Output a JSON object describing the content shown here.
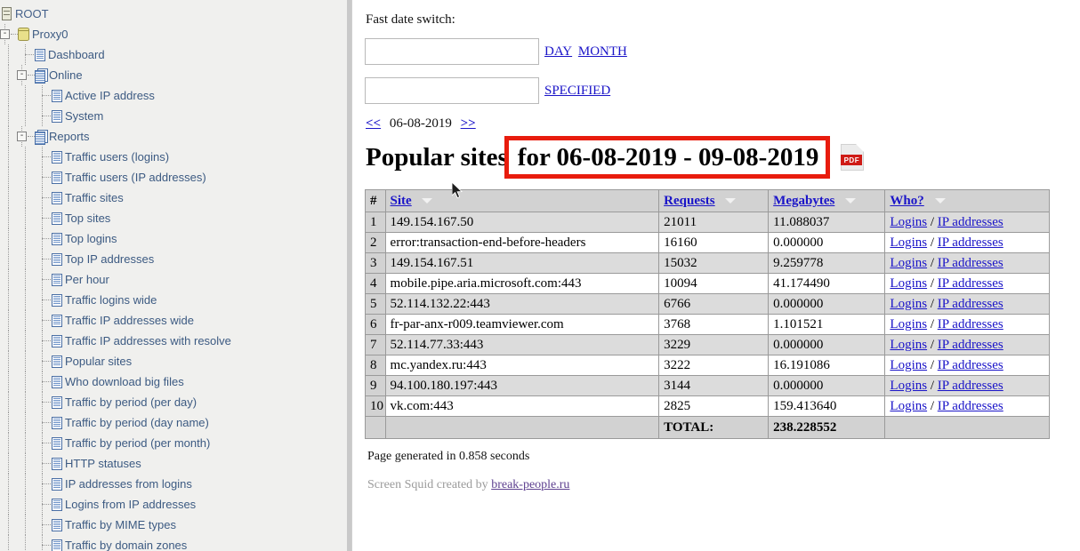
{
  "sidebar": {
    "root_label": "ROOT",
    "root_icon": "server-stack-icon",
    "items": [
      {
        "label": "Proxy0",
        "depth": 1,
        "icon": "cylinder-icon",
        "toggle": "-"
      },
      {
        "label": "Dashboard",
        "depth": 2,
        "icon": "page-icon",
        "toggle": ""
      },
      {
        "label": "Online",
        "depth": 2,
        "icon": "multi-page-icon",
        "toggle": "-"
      },
      {
        "label": "Active IP address",
        "depth": 3,
        "icon": "page-icon",
        "toggle": ""
      },
      {
        "label": "System",
        "depth": 3,
        "icon": "page-icon",
        "toggle": ""
      },
      {
        "label": "Reports",
        "depth": 2,
        "icon": "multi-page-icon",
        "toggle": "-"
      },
      {
        "label": "Traffic users (logins)",
        "depth": 3,
        "icon": "page-icon",
        "toggle": ""
      },
      {
        "label": "Traffic users (IP addresses)",
        "depth": 3,
        "icon": "page-icon",
        "toggle": ""
      },
      {
        "label": "Traffic sites",
        "depth": 3,
        "icon": "page-icon",
        "toggle": ""
      },
      {
        "label": "Top sites",
        "depth": 3,
        "icon": "page-icon",
        "toggle": ""
      },
      {
        "label": "Top logins",
        "depth": 3,
        "icon": "page-icon",
        "toggle": ""
      },
      {
        "label": "Top IP addresses",
        "depth": 3,
        "icon": "page-icon",
        "toggle": ""
      },
      {
        "label": "Per hour",
        "depth": 3,
        "icon": "page-icon",
        "toggle": ""
      },
      {
        "label": "Traffic logins wide",
        "depth": 3,
        "icon": "page-icon",
        "toggle": ""
      },
      {
        "label": "Traffic IP addresses wide",
        "depth": 3,
        "icon": "page-icon",
        "toggle": ""
      },
      {
        "label": "Traffic IP addresses with resolve",
        "depth": 3,
        "icon": "page-icon",
        "toggle": ""
      },
      {
        "label": "Popular sites",
        "depth": 3,
        "icon": "page-icon",
        "toggle": ""
      },
      {
        "label": "Who download big files",
        "depth": 3,
        "icon": "page-icon",
        "toggle": ""
      },
      {
        "label": "Traffic by period (per day)",
        "depth": 3,
        "icon": "page-icon",
        "toggle": ""
      },
      {
        "label": "Traffic by period (day name)",
        "depth": 3,
        "icon": "page-icon",
        "toggle": ""
      },
      {
        "label": "Traffic by period (per month)",
        "depth": 3,
        "icon": "page-icon",
        "toggle": ""
      },
      {
        "label": "HTTP statuses",
        "depth": 3,
        "icon": "page-icon",
        "toggle": ""
      },
      {
        "label": "IP addresses from logins",
        "depth": 3,
        "icon": "page-icon",
        "toggle": ""
      },
      {
        "label": "Logins from IP addresses",
        "depth": 3,
        "icon": "page-icon",
        "toggle": ""
      },
      {
        "label": "Traffic by MIME types",
        "depth": 3,
        "icon": "page-icon",
        "toggle": ""
      },
      {
        "label": "Traffic by domain zones",
        "depth": 3,
        "icon": "page-icon",
        "toggle": ""
      }
    ]
  },
  "main": {
    "fast_date_switch_label": "Fast date switch:",
    "date_input_1": "",
    "date_input_2": "",
    "date_input_placeholder": "",
    "link_day": "DAY",
    "link_month": "MONTH",
    "link_specified": "SPECIFIED",
    "nav_prev": "<<",
    "nav_date": "06-08-2019",
    "nav_next": ">>",
    "title_prefix": "Popular sites",
    "title_highlighted": "for 06-08-2019 - 09-08-2019",
    "highlight_color": "#e81c0d",
    "pdf_icon_label": "PDF",
    "generated_text": "Page generated in 0.858 seconds",
    "credit_prefix": "Screen Squid created by ",
    "credit_link": "break-people.ru"
  },
  "table": {
    "columns": [
      "#",
      "Site",
      "Requests",
      "Megabytes",
      "Who?"
    ],
    "who_login_label": "Logins",
    "who_sep": " / ",
    "who_ip_label": "IP addresses",
    "total_label": "TOTAL:",
    "total_value": "238.228552",
    "rows": [
      {
        "num": "1",
        "site": "149.154.167.50",
        "requests": "21011",
        "megabytes": "11.088037"
      },
      {
        "num": "2",
        "site": "error:transaction-end-before-headers",
        "requests": "16160",
        "megabytes": "0.000000"
      },
      {
        "num": "3",
        "site": "149.154.167.51",
        "requests": "15032",
        "megabytes": "9.259778"
      },
      {
        "num": "4",
        "site": "mobile.pipe.aria.microsoft.com:443",
        "requests": "10094",
        "megabytes": "41.174490"
      },
      {
        "num": "5",
        "site": "52.114.132.22:443",
        "requests": "6766",
        "megabytes": "0.000000"
      },
      {
        "num": "6",
        "site": "fr-par-anx-r009.teamviewer.com",
        "requests": "3768",
        "megabytes": "1.101521"
      },
      {
        "num": "7",
        "site": "52.114.77.33:443",
        "requests": "3229",
        "megabytes": "0.000000"
      },
      {
        "num": "8",
        "site": "mc.yandex.ru:443",
        "requests": "3222",
        "megabytes": "16.191086"
      },
      {
        "num": "9",
        "site": "94.100.180.197:443",
        "requests": "3144",
        "megabytes": "0.000000"
      },
      {
        "num": "10",
        "site": "vk.com:443",
        "requests": "2825",
        "megabytes": "159.413640"
      }
    ]
  }
}
